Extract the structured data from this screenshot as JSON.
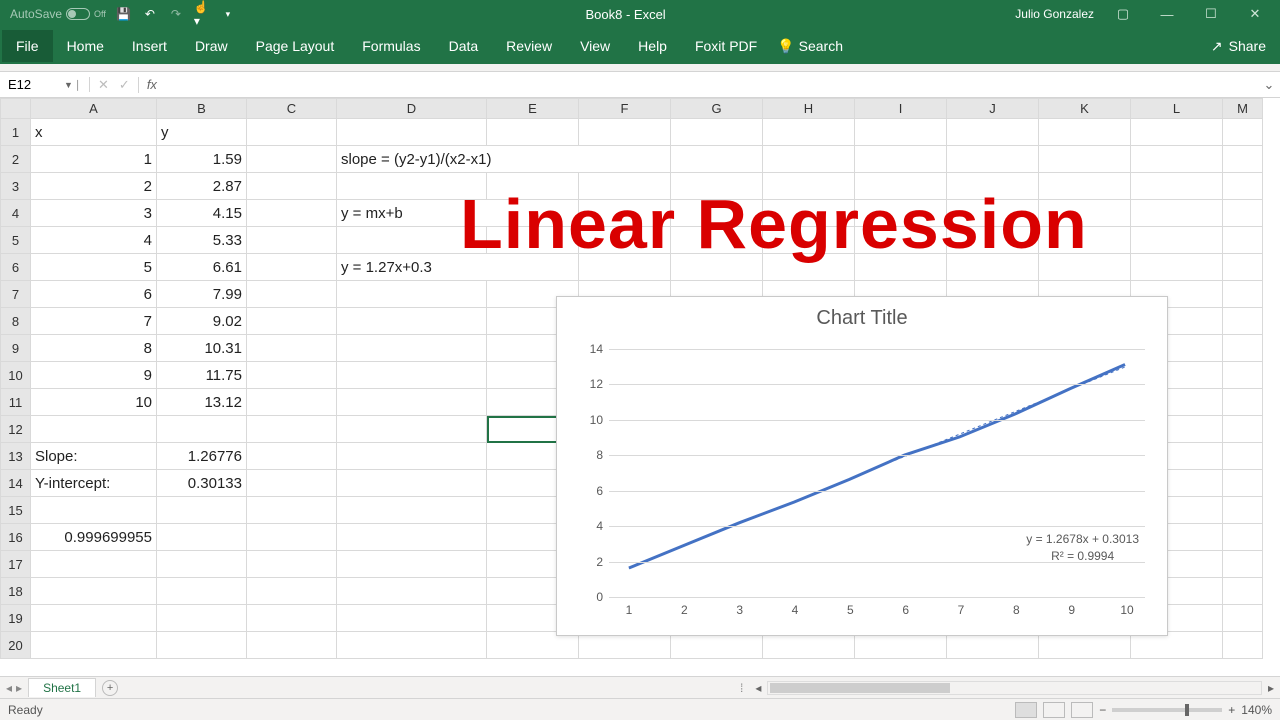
{
  "title_center": "Book8  -  Excel",
  "user": "Julio Gonzalez",
  "autosave_label": "AutoSave",
  "autosave_state": "Off",
  "share_label": "Share",
  "ribbon_tabs": [
    "File",
    "Home",
    "Insert",
    "Draw",
    "Page Layout",
    "Formulas",
    "Data",
    "Review",
    "View",
    "Help",
    "Foxit PDF"
  ],
  "tellme": "Search",
  "namebox": "E12",
  "fx_label": "fx",
  "columns": [
    "A",
    "B",
    "C",
    "D",
    "E",
    "F",
    "G",
    "H",
    "I",
    "J",
    "K",
    "L",
    "M"
  ],
  "rows": 20,
  "cells": {
    "A1": "x",
    "B1": "y",
    "A2": "1",
    "B2": "1.59",
    "A3": "2",
    "B3": "2.87",
    "A4": "3",
    "B4": "4.15",
    "A5": "4",
    "B5": "5.33",
    "A6": "5",
    "B6": "6.61",
    "A7": "6",
    "B7": "7.99",
    "A8": "7",
    "B8": "9.02",
    "A9": "8",
    "B9": "10.31",
    "A10": "9",
    "B10": "11.75",
    "A11": "10",
    "B11": "13.12",
    "A13": "Slope:",
    "B13": "1.26776",
    "A14": "Y-intercept:",
    "B14": "0.30133",
    "A16": "0.999699955",
    "D2": "slope = (y2-y1)/(x2-x1)",
    "D4": "y = mx+b",
    "D6": "y = 1.27x+0.3"
  },
  "overlay_headline": "Linear Regression",
  "chart_data": {
    "type": "line",
    "title": "Chart Title",
    "x": [
      1,
      2,
      3,
      4,
      5,
      6,
      7,
      8,
      9,
      10
    ],
    "series": [
      {
        "name": "y",
        "values": [
          1.59,
          2.87,
          4.15,
          5.33,
          6.61,
          7.99,
          9.02,
          10.31,
          11.75,
          13.12
        ]
      }
    ],
    "y_ticks": [
      0,
      2,
      4,
      6,
      8,
      10,
      12,
      14
    ],
    "ylim": [
      0,
      14
    ],
    "trendline_eq": "y = 1.2678x + 0.3013",
    "trendline_r2": "R² = 0.9994"
  },
  "sheet_tab": "Sheet1",
  "status_ready": "Ready",
  "zoom": "140%"
}
